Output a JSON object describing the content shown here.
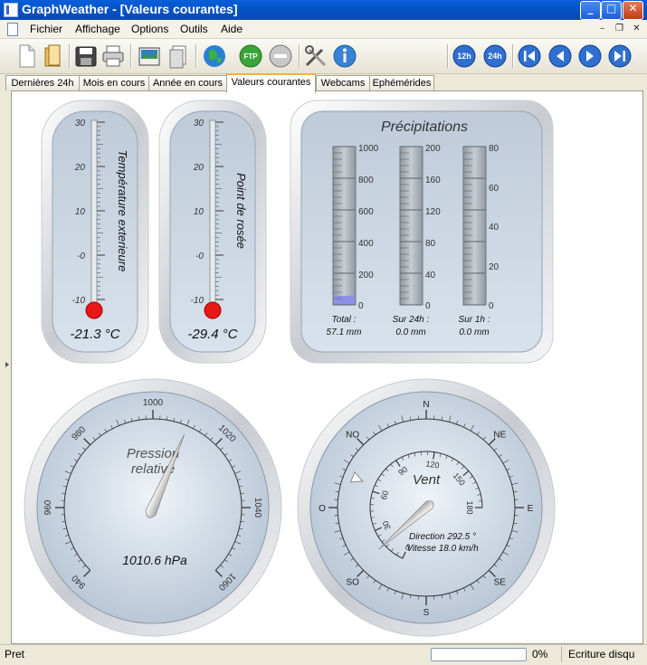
{
  "window": {
    "title": "GraphWeather - [Valeurs courantes]"
  },
  "menu": [
    "Fichier",
    "Affichage",
    "Options",
    "Outils",
    "Aide"
  ],
  "toolbar_icons": [
    "new-file-icon",
    "open-folder-icon",
    "save-icon",
    "print-icon",
    "export-image-icon",
    "print-preview-icon",
    "globe-icon",
    "ftp-icon",
    "stop-icon",
    "tools-icon",
    "info-icon",
    "12h-icon",
    "24h-icon",
    "first-icon",
    "previous-icon",
    "next-icon",
    "last-icon"
  ],
  "toolbar_labels": {
    "ftp": "FTP",
    "h12": "12h",
    "h24": "24h"
  },
  "tabs": [
    "Dernières 24h",
    "Mois en cours",
    "Année en cours",
    "Valeurs courantes",
    "Webcams",
    "Ephémérides"
  ],
  "active_tab": "Valeurs courantes",
  "thermo_outdoor": {
    "label": "Température exterieure",
    "scale": [
      "30",
      "20",
      "10",
      "-0",
      "-10"
    ],
    "value": -21.3,
    "value_text": "-21.3 °C"
  },
  "thermo_dew": {
    "label": "Point de rosée",
    "scale": [
      "30",
      "20",
      "10",
      "-0",
      "-10"
    ],
    "value": -29.4,
    "value_text": "-29.4 °C"
  },
  "precip": {
    "title": "Précipitations",
    "total": {
      "label": "Total :",
      "value": 57.1,
      "value_text": "57.1 mm",
      "max": 1000,
      "scale": [
        "1000",
        "800",
        "600",
        "400",
        "200",
        "0"
      ]
    },
    "day": {
      "label": "Sur 24h :",
      "value": 0.0,
      "value_text": "0.0 mm",
      "max": 200,
      "scale": [
        "200",
        "160",
        "120",
        "80",
        "40",
        "0"
      ]
    },
    "hour": {
      "label": "Sur 1h :",
      "value": 0.0,
      "value_text": "0.0 mm",
      "max": 80,
      "scale": [
        "80",
        "60",
        "40",
        "20",
        "0"
      ]
    }
  },
  "pressure": {
    "title_line1": "Pression",
    "title_line2": "relative",
    "value": 1010.6,
    "value_text": "1010.6 hPa",
    "scale_labels": [
      "940",
      "960",
      "980",
      "1000",
      "1020",
      "1040",
      "1060"
    ],
    "min": 940,
    "max": 1060
  },
  "wind": {
    "title": "Vent",
    "direction_text": "Direction 292.5 °",
    "speed_text": "Vitesse 18.0 km/h",
    "direction": 292.5,
    "speed": 18.0,
    "compass": [
      "N",
      "NE",
      "E",
      "SE",
      "S",
      "SO",
      "O",
      "NO"
    ],
    "speed_scale": [
      "0",
      "30",
      "60",
      "90",
      "120",
      "150",
      "180"
    ]
  },
  "status": {
    "left": "Pret",
    "progress_text": "0%",
    "progress": 0,
    "right": "Ecriture disqu"
  }
}
